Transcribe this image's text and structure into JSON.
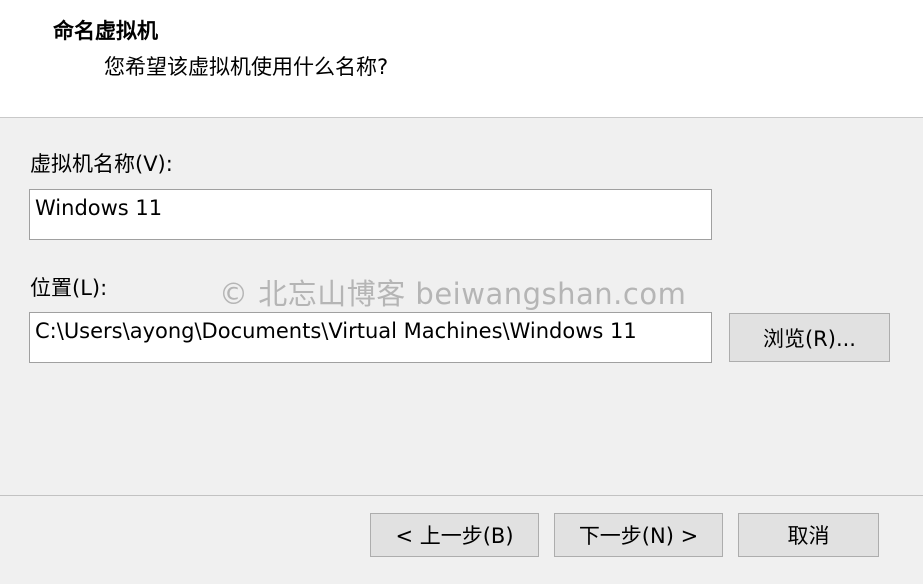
{
  "header": {
    "title": "命名虚拟机",
    "subtitle": "您希望该虚拟机使用什么名称?"
  },
  "vm_name": {
    "label": "虚拟机名称(V):",
    "value": "Windows 11"
  },
  "location": {
    "label": "位置(L):",
    "value": "C:\\Users\\ayong\\Documents\\Virtual Machines\\Windows 11",
    "browse_label": "浏览(R)..."
  },
  "watermark": "© 北忘山博客 beiwangshan.com",
  "footer": {
    "back_label": "< 上一步(B)",
    "next_label": "下一步(N) >",
    "cancel_label": "取消"
  },
  "colors": {
    "window_bg": "#f0f0f0",
    "header_bg": "#ffffff",
    "button_bg": "#e1e1e1",
    "button_border": "#adadad",
    "watermark": "#b5b5b5"
  }
}
